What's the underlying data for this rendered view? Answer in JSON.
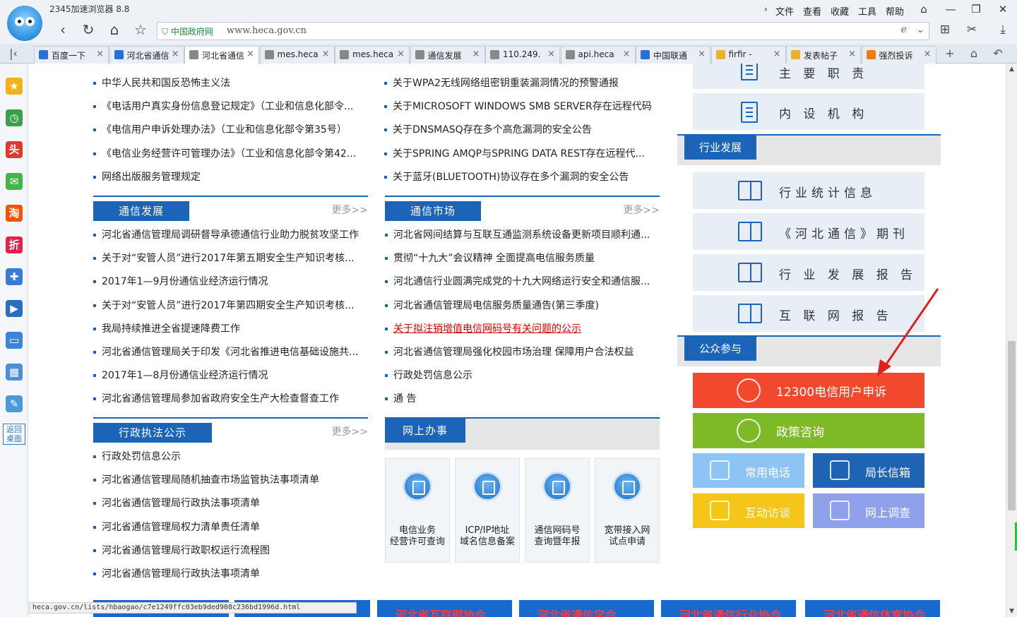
{
  "browser": {
    "title": "2345加速浏览器 8.8",
    "menu": [
      "文件",
      "查看",
      "收藏",
      "工具",
      "帮助"
    ],
    "address": {
      "badge": "中国政府网",
      "url": "www.heca.gov.cn"
    },
    "tabs": [
      {
        "label": "百度一下",
        "color": "#2b6fd6",
        "active": false
      },
      {
        "label": "河北省通信",
        "color": "#2b6fd6",
        "active": false
      },
      {
        "label": "河北省通信",
        "color": "#888888",
        "active": true
      },
      {
        "label": "mes.heca",
        "color": "#888888",
        "active": false
      },
      {
        "label": "mes.heca",
        "color": "#888888",
        "active": false
      },
      {
        "label": "通信发展",
        "color": "#888888",
        "active": false
      },
      {
        "label": "110.249.",
        "color": "#888888",
        "active": false
      },
      {
        "label": "api.heca",
        "color": "#888888",
        "active": false
      },
      {
        "label": "中国联通",
        "color": "#2b6fd6",
        "active": false
      },
      {
        "label": "firfir -",
        "color": "#e8b12e",
        "active": false
      },
      {
        "label": "发表帖子",
        "color": "#e8b12e",
        "active": false
      },
      {
        "label": "强烈投诉",
        "color": "#f07a18",
        "active": false
      }
    ],
    "status_url": "heca.gov.cn/lists/hbaogao/c7e1249ffc03eb9ded908c236bd1996d.html"
  },
  "sidebar": {
    "items": [
      {
        "name": "favorites-star-icon",
        "glyph": "★",
        "color": "#f2b21b"
      },
      {
        "name": "history-clock-icon",
        "glyph": "◷",
        "color": "#3aa04a"
      },
      {
        "name": "headlines-icon",
        "glyph": "头",
        "color": "#e03a2f"
      },
      {
        "name": "wechat-icon",
        "glyph": "✉",
        "color": "#44b549"
      },
      {
        "name": "taobao-icon",
        "glyph": "淘",
        "color": "#ff5000"
      },
      {
        "name": "discount-icon",
        "glyph": "折",
        "color": "#e5204a"
      },
      {
        "name": "game-controller-icon",
        "glyph": "✚",
        "color": "#3a7bd5"
      },
      {
        "name": "video-icon",
        "glyph": "▶",
        "color": "#2a6ebd"
      },
      {
        "name": "computer-icon",
        "glyph": "▭",
        "color": "#3a86d4"
      },
      {
        "name": "calculator-icon",
        "glyph": "▦",
        "color": "#4a8fd8"
      },
      {
        "name": "notebook-icon",
        "glyph": "✎",
        "color": "#4a9ad8"
      }
    ],
    "back_desktop": "返回桌面"
  },
  "page": {
    "left_top_list": [
      "中华人民共和国反恐怖主义法",
      "《电话用户真实身份信息登记规定》（工业和信息化部令...",
      "《电信用户申诉处理办法》（工业和信息化部令第35号）",
      "《电信业务经营许可管理办法》（工业和信息化部令第42...",
      "网络出版服务管理规定"
    ],
    "mid_top_list": [
      "关于WPA2无线网络组密钥重装漏洞情况的预警通报",
      "关于MICROSOFT WINDOWS SMB SERVER存在远程代码...",
      "关于DNSMASQ存在多个高危漏洞的安全公告",
      "关于SPRING AMQP与SPRING DATA REST存在远程代...",
      "关于蓝牙(BLUETOOTH)协议存在多个漏洞的安全公告"
    ],
    "comm_dev": {
      "title": "通信发展",
      "more": "更多>>",
      "items": [
        "河北省通信管理局调研督导承德通信行业助力脱贫攻坚工作",
        "关于对“安管人员”进行2017年第五期安全生产知识考核...",
        "2017年1—9月份通信业经济运行情况",
        "关于对“安管人员”进行2017年第四期安全生产知识考核...",
        "我局持续推进全省提速降费工作",
        "河北省通信管理局关于印发《河北省推进电信基础设施共...",
        "2017年1—8月份通信业经济运行情况",
        "河北省通信管理局参加省政府安全生产大检查督查工作"
      ]
    },
    "comm_market": {
      "title": "通信市场",
      "more": "更多>>",
      "items": [
        "河北省网间结算与互联互通监测系统设备更新项目顺利通...",
        "贯彻“十九大”会议精神 全面提高电信服务质量",
        "河北通信行业圆满完成党的十九大网络运行安全和通信服...",
        "河北省通信管理局电信服务质量通告(第三季度)",
        "关于拟注销增值电信网码号有关问题的公示",
        "河北省通信管理局强化校园市场治理 保障用户合法权益",
        "行政处罚信息公示",
        "通 告"
      ],
      "highlight_index": 4
    },
    "admin_law": {
      "title": "行政执法公示",
      "more": "更多>>",
      "items": [
        "行政处罚信息公示",
        "河北省通信管理局随机抽查市场监管执法事项清单",
        "河北省通信管理局行政执法事项清单",
        "河北省通信管理局权力清单责任清单",
        "河北省通信管理局行政职权运行流程图",
        "河北省通信管理局行政执法事项清单"
      ]
    },
    "online": {
      "title": "网上办事",
      "services": [
        {
          "line1": "电信业务",
          "line2": "经营许可查询"
        },
        {
          "line1": "ICP/IP地址",
          "line2": "域名信息备案"
        },
        {
          "line1": "通信网码号",
          "line2": "查询暨年报"
        },
        {
          "line1": "宽带接入网",
          "line2": "试点申请"
        }
      ]
    },
    "right": {
      "top_links": [
        "主 要 职 责",
        "内 设 机 构"
      ],
      "industry_title": "行业发展",
      "industry_links": [
        "行业统计信息",
        "《河北通信》期刊",
        "行 业 发 展 报 告",
        "互 联 网 报 告"
      ],
      "public_title": "公众参与",
      "complaint": "12300电信用户申诉",
      "policy": "政策咨询",
      "small": [
        {
          "label": "常用电话",
          "color": "#8dc4f6"
        },
        {
          "label": "局长信箱",
          "color": "#1f63b5"
        },
        {
          "label": "互动访谈",
          "color": "#f5c518"
        },
        {
          "label": "网上调查",
          "color": "#8ea1ea"
        }
      ],
      "complaint_color": "#f2492e",
      "policy_color": "#7eba28"
    },
    "banners": [
      "",
      "",
      "河北省互联网协会",
      "河北省通信学会",
      "河北省通信行业协会",
      "河北省通信体育协会"
    ]
  }
}
